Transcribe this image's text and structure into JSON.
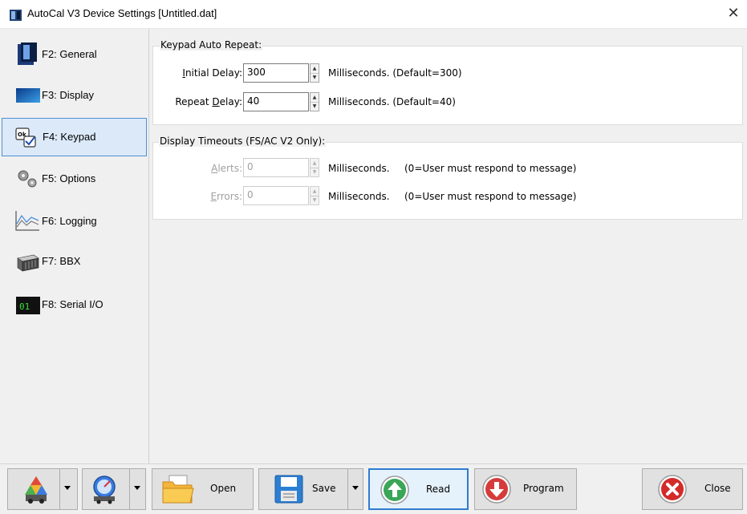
{
  "window": {
    "title": "AutoCal V3 Device Settings [Untitled.dat]"
  },
  "sidebar": {
    "items": [
      {
        "label": "F2: General",
        "icon": "general-icon"
      },
      {
        "label": "F3: Display",
        "icon": "display-icon"
      },
      {
        "label": "F4: Keypad",
        "icon": "keypad-icon",
        "active": true
      },
      {
        "label": "F5: Options",
        "icon": "options-gears-icon"
      },
      {
        "label": "F6: Logging",
        "icon": "logging-chart-icon"
      },
      {
        "label": "F7: BBX",
        "icon": "bbx-icon"
      },
      {
        "label": "F8: Serial I/O",
        "icon": "serial-io-icon"
      }
    ]
  },
  "keypad_auto_repeat": {
    "title": "Keypad Auto Repeat:",
    "initial_delay": {
      "label_pre": "",
      "label_mnemonic": "I",
      "label_post": "nitial Delay:",
      "value": "300",
      "unit": "Milliseconds. (Default=300)"
    },
    "repeat_delay": {
      "label_pre": "Repeat ",
      "label_mnemonic": "D",
      "label_post": "elay:",
      "value": "40",
      "unit": "Milliseconds. (Default=40)"
    }
  },
  "display_timeouts": {
    "title": "Display Timeouts (FS/AC V2 Only):",
    "alerts": {
      "label_mnemonic": "A",
      "label_post": "lerts:",
      "value": "0",
      "unit": "Milliseconds.",
      "note": "(0=User must respond to message)"
    },
    "errors": {
      "label_mnemonic": "E",
      "label_post": "rrors:",
      "value": "0",
      "unit": "Milliseconds.",
      "note": "(0=User must respond to message)"
    }
  },
  "toolbar": {
    "open_label": "Open",
    "save_label": "Save",
    "read_label": "Read",
    "program_label": "Program",
    "close_label": "Close"
  },
  "colors": {
    "accent_blue": "#2f7bd0",
    "read_green": "#3aa657",
    "program_red": "#d63b3b",
    "close_red": "#d42a2a"
  }
}
